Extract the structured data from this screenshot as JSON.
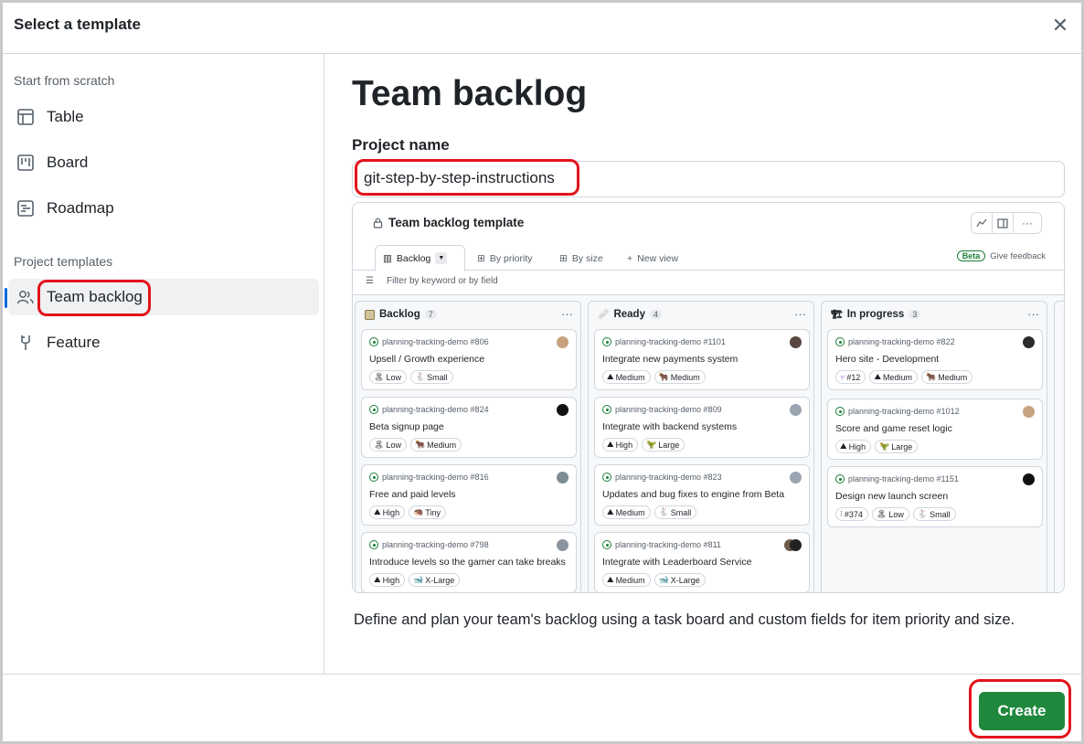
{
  "dialog": {
    "title": "Select a template"
  },
  "sidebar": {
    "section_scratch": "Start from scratch",
    "scratch_items": [
      {
        "label": "Table",
        "icon": "table-icon"
      },
      {
        "label": "Board",
        "icon": "board-icon"
      },
      {
        "label": "Roadmap",
        "icon": "roadmap-icon"
      }
    ],
    "section_templates": "Project templates",
    "template_items": [
      {
        "label": "Team backlog",
        "icon": "people-icon",
        "selected": true
      },
      {
        "label": "Feature",
        "icon": "feature-icon",
        "selected": false
      }
    ]
  },
  "main": {
    "heading": "Team backlog",
    "project_name_label": "Project name",
    "project_name_value": "git-step-by-step-instructions",
    "description": "Define and plan your team's backlog using a task board and custom fields for item priority and size."
  },
  "preview": {
    "title": "Team backlog template",
    "tabs": [
      "Backlog",
      "By priority",
      "By size",
      "New view"
    ],
    "beta_badge": "Beta",
    "feedback": "Give feedback",
    "filter_placeholder": "Filter by keyword or by field",
    "columns": [
      {
        "name": "Backlog",
        "count": "7",
        "cards": [
          {
            "ref": "planning-tracking-demo #806",
            "title": "Upsell / Growth experience",
            "tags": [
              "Low",
              "Small"
            ]
          },
          {
            "ref": "planning-tracking-demo #824",
            "title": "Beta signup page",
            "tags": [
              "Low",
              "Medium"
            ]
          },
          {
            "ref": "planning-tracking-demo #816",
            "title": "Free and paid levels",
            "tags": [
              "High",
              "Tiny"
            ]
          },
          {
            "ref": "planning-tracking-demo #798",
            "title": "Introduce levels so the gamer can take breaks",
            "tags": [
              "High",
              "X-Large"
            ]
          }
        ]
      },
      {
        "name": "Ready",
        "count": "4",
        "cards": [
          {
            "ref": "planning-tracking-demo #1101",
            "title": "Integrate new payments system",
            "tags": [
              "Medium",
              "Medium"
            ]
          },
          {
            "ref": "planning-tracking-demo #809",
            "title": "Integrate with backend systems",
            "tags": [
              "High",
              "Large"
            ]
          },
          {
            "ref": "planning-tracking-demo #823",
            "title": "Updates and bug fixes to engine from Beta",
            "tags": [
              "Medium",
              "Small"
            ]
          },
          {
            "ref": "planning-tracking-demo #811",
            "title": "Integrate with Leaderboard Service",
            "tags": [
              "Medium",
              "X-Large"
            ]
          }
        ]
      },
      {
        "name": "In progress",
        "count": "3",
        "cards": [
          {
            "ref": "planning-tracking-demo #822",
            "title": "Hero site - Development",
            "tags": [
              "#12",
              "Medium",
              "Medium"
            ]
          },
          {
            "ref": "planning-tracking-demo #1012",
            "title": "Score and game reset logic",
            "tags": [
              "High",
              "Large"
            ]
          },
          {
            "ref": "planning-tracking-demo #1151",
            "title": "Design new launch screen",
            "tags": [
              "#374",
              "Low",
              "Small"
            ]
          }
        ]
      }
    ]
  },
  "footer": {
    "create_label": "Create"
  },
  "colors": {
    "accent": "#0969da",
    "create": "#1f883d",
    "highlight": "#e3131b"
  }
}
